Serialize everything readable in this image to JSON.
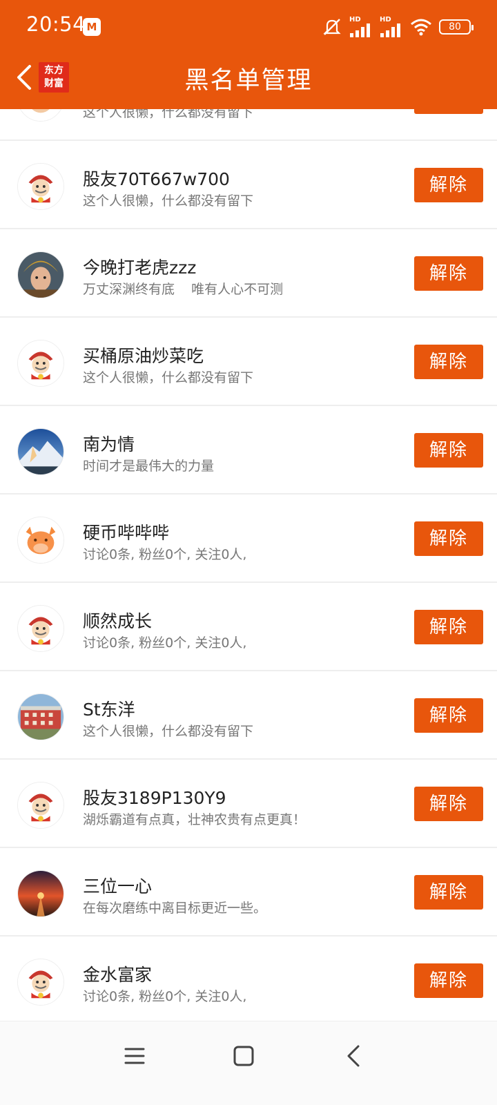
{
  "status": {
    "time": "20:54",
    "app_badge": "M",
    "battery": "80",
    "hd1": "HD",
    "hd2": "HD"
  },
  "nav": {
    "title": "黑名单管理",
    "logo_line1": "东方",
    "logo_line2": "财富"
  },
  "list": {
    "unblock_label": "解除",
    "items": [
      {
        "name": "",
        "desc": "这个人很懒，什么都没有留下",
        "avatar": "mascot"
      },
      {
        "name": "股友70T667w700",
        "desc": "这个人很懒，什么都没有留下",
        "avatar": "mascot"
      },
      {
        "name": "今晚打老虎zzz",
        "desc": "万丈深渊终有底    唯有人心不可测",
        "avatar": "photo-person"
      },
      {
        "name": "买桶原油炒菜吃",
        "desc": "这个人很懒，什么都没有留下",
        "avatar": "mascot"
      },
      {
        "name": "南为情",
        "desc": "时间才是最伟大的力量",
        "avatar": "photo-mountain"
      },
      {
        "name": "硬币哔哔哔",
        "desc": "讨论0条, 粉丝0个, 关注0人,",
        "avatar": "cow"
      },
      {
        "name": "顺然成长",
        "desc": "讨论0条, 粉丝0个, 关注0人,",
        "avatar": "mascot"
      },
      {
        "name": "St东洋",
        "desc": "这个人很懒，什么都没有留下",
        "avatar": "photo-building"
      },
      {
        "name": "股友3189P130Y9",
        "desc": "湖烁霸道有点真，壮神农贵有点更真！",
        "avatar": "mascot"
      },
      {
        "name": "三位一心",
        "desc": "在每次磨练中离目标更近一些。",
        "avatar": "photo-sunset"
      },
      {
        "name": "金水富家",
        "desc": "讨论0条, 粉丝0个, 关注0人,",
        "avatar": "mascot"
      }
    ]
  }
}
